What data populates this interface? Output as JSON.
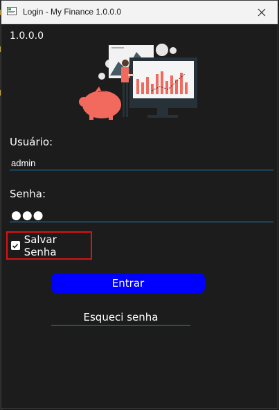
{
  "window": {
    "title": "Login - My Finance 1.0.0.0"
  },
  "app": {
    "version": "1.0.0.0"
  },
  "form": {
    "user_label": "Usuário:",
    "user_value": "admin",
    "password_label": "Senha:",
    "password_mask": "●●●",
    "remember_label": "Salvar Senha",
    "remember_checked": true,
    "login_button": "Entrar",
    "forgot_link": "Esqueci senha"
  },
  "colors": {
    "window_bg": "#1c1c1c",
    "primary_button": "#0000ff",
    "field_underline": "#1f86c8",
    "highlight_border": "#e01010",
    "illustration_accent": "#f26a5e"
  },
  "icons": [
    "app-icon",
    "close-icon",
    "checkmark-icon"
  ]
}
